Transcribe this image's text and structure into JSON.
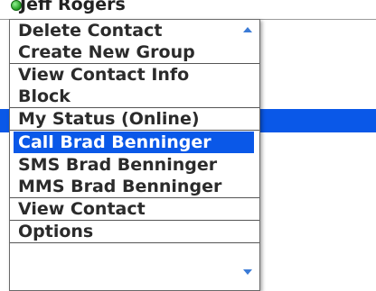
{
  "header": {
    "contact_name": "Jeff Rogers"
  },
  "menu": {
    "groups": [
      {
        "items": [
          "Delete Contact",
          "Create New Group"
        ]
      },
      {
        "items": [
          "View Contact Info",
          "Block"
        ]
      },
      {
        "items": [
          "My Status (Online)"
        ]
      },
      {
        "items": [
          "Call Brad Benninger",
          "SMS Brad Benninger",
          "MMS Brad Benninger"
        ],
        "selected_index": 0
      },
      {
        "items": [
          "View Contact"
        ]
      },
      {
        "items": [
          "Options"
        ]
      }
    ]
  },
  "colors": {
    "selection": "#0a58e8",
    "status_online": "#1f9b1f"
  },
  "icons": {
    "status": "online-status-icon",
    "scroll_up": "scroll-up-arrow-icon",
    "scroll_down": "scroll-down-arrow-icon"
  }
}
